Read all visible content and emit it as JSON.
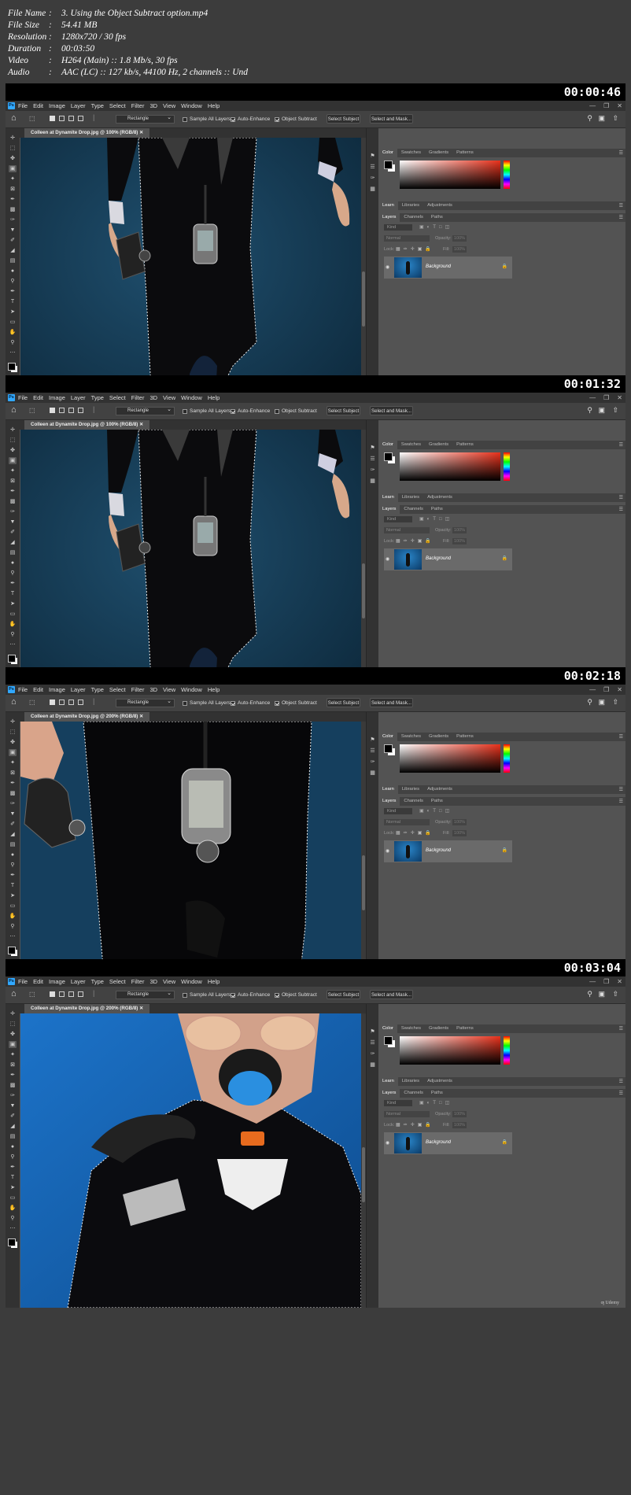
{
  "metadata": [
    {
      "key": "File Name",
      "value": "3. Using the Object Subtract option.mp4"
    },
    {
      "key": "File Size",
      "value": "54.41 MB"
    },
    {
      "key": "Resolution",
      "value": "1280x720 / 30 fps"
    },
    {
      "key": "Duration",
      "value": "00:03:50"
    },
    {
      "key": "Video",
      "value": "H264 (Main) :: 1.8 Mb/s, 30 fps"
    },
    {
      "key": "Audio",
      "value": "AAC (LC) :: 127 kb/s, 44100 Hz, 2 channels :: Und"
    }
  ],
  "separator": ":",
  "menu": [
    "File",
    "Edit",
    "Image",
    "Layer",
    "Type",
    "Select",
    "Filter",
    "3D",
    "View",
    "Window",
    "Help"
  ],
  "ps_logo": "Ps",
  "options": {
    "mode": "Rectangle",
    "sample_all_layers": "Sample All Layers",
    "auto_enhance": "Auto-Enhance",
    "object_subtract": "Object Subtract",
    "select_subject": "Select Subject",
    "select_and_mask": "Select and Mask..."
  },
  "panels": {
    "color_tabs": [
      "Color",
      "Swatches",
      "Gradients",
      "Patterns"
    ],
    "learn_tabs": [
      "Learn",
      "Libraries",
      "Adjustments"
    ],
    "layer_tabs": [
      "Layers",
      "Channels",
      "Paths"
    ],
    "kind": "Kind",
    "blend_mode": "Normal",
    "opacity_label": "Opacity:",
    "opacity_value": "100%",
    "lock_label": "Lock:",
    "fill_label": "Fill:",
    "fill_value": "100%",
    "layer_name": "Background"
  },
  "watermark": "Udemy",
  "frames": [
    {
      "timestamp": "00:00:46",
      "doc_tab": "Colleen at Dynamite Drop.jpg @ 100% (RGB/8)",
      "object_subtract_checked": true,
      "scene": "legs"
    },
    {
      "timestamp": "00:01:32",
      "doc_tab": "Colleen at Dynamite Drop.jpg @ 100% (RGB/8)",
      "object_subtract_checked": false,
      "scene": "legs"
    },
    {
      "timestamp": "00:02:18",
      "doc_tab": "Colleen at Dynamite Drop.jpg @ 200% (RGB/8)",
      "object_subtract_checked": true,
      "scene": "gauge"
    },
    {
      "timestamp": "00:03:04",
      "doc_tab": "Colleen at Dynamite Drop.jpg @ 200% (RGB/8)",
      "object_subtract_checked": true,
      "scene": "face"
    }
  ]
}
